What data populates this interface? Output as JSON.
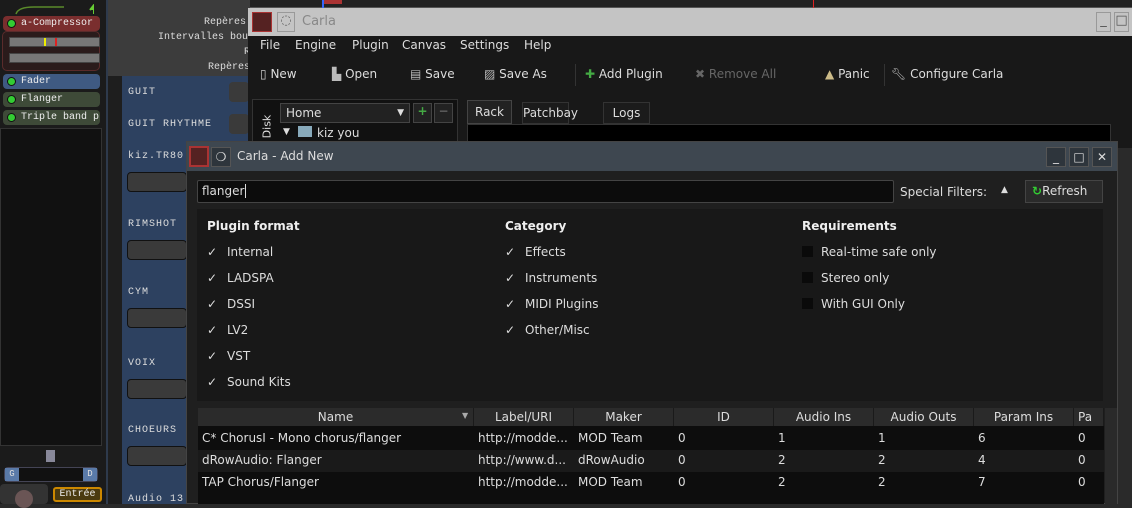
{
  "left_panel": {
    "plugins": [
      {
        "label": "a-Compressor",
        "color": "#7a2e2e"
      },
      {
        "label": "Fader",
        "color": "#3f5a82"
      },
      {
        "label": "Flanger",
        "color": "#3e4a38"
      },
      {
        "label": "Triple band p",
        "color": "#3e4a38"
      }
    ],
    "pan_left": "G",
    "pan_right": "D",
    "input_button": "Entrée"
  },
  "timeline_labels": [
    "Repères",
    "Intervalles bouc",
    "R",
    "Repères"
  ],
  "tracks": [
    "GUIT",
    "GUIT RHYTHME",
    "kiz.TR80",
    "RIMSHOT",
    "CYM",
    "VOIX",
    "CHOEURS",
    "Audio 13"
  ],
  "carla": {
    "title": "Carla",
    "menu": [
      "File",
      "Engine",
      "Plugin",
      "Canvas",
      "Settings",
      "Help"
    ],
    "toolbar": [
      {
        "label": "New",
        "icon": "new-file-icon",
        "enabled": true
      },
      {
        "label": "Open",
        "icon": "open-icon",
        "enabled": true
      },
      {
        "label": "Save",
        "icon": "save-icon",
        "enabled": true
      },
      {
        "label": "Save As",
        "icon": "save-as-icon",
        "enabled": true
      },
      {
        "label": "Add Plugin",
        "icon": "plus-icon",
        "enabled": true
      },
      {
        "label": "Remove All",
        "icon": "x-icon",
        "enabled": false
      },
      {
        "label": "Panic",
        "icon": "warning-icon",
        "enabled": true
      },
      {
        "label": "Configure Carla",
        "icon": "wrench-icon",
        "enabled": true
      }
    ],
    "disk_label": "Disk",
    "disk_select": "Home",
    "tree_item": "kiz you",
    "tabs": [
      "Rack",
      "Patchbay",
      "Logs"
    ]
  },
  "dialog": {
    "title": "Carla - Add New",
    "search_value": "flanger",
    "special_filters": "Special Filters:",
    "refresh": "Refresh",
    "plugin_format": {
      "heading": "Plugin format",
      "items": [
        {
          "label": "Internal",
          "checked": true
        },
        {
          "label": "LADSPA",
          "checked": true
        },
        {
          "label": "DSSI",
          "checked": true
        },
        {
          "label": "LV2",
          "checked": true
        },
        {
          "label": "VST",
          "checked": true
        },
        {
          "label": "Sound Kits",
          "checked": true
        }
      ]
    },
    "category": {
      "heading": "Category",
      "items": [
        {
          "label": "Effects",
          "checked": true
        },
        {
          "label": "Instruments",
          "checked": true
        },
        {
          "label": "MIDI Plugins",
          "checked": true
        },
        {
          "label": "Other/Misc",
          "checked": true
        }
      ]
    },
    "requirements": {
      "heading": "Requirements",
      "items": [
        {
          "label": "Real-time safe only",
          "checked": false
        },
        {
          "label": "Stereo only",
          "checked": false
        },
        {
          "label": "With GUI Only",
          "checked": false
        }
      ]
    },
    "table": {
      "columns": [
        "Name",
        "Label/URI",
        "Maker",
        "ID",
        "Audio Ins",
        "Audio Outs",
        "Param Ins",
        "Pa"
      ],
      "rows": [
        [
          "C* ChorusI - Mono chorus/flanger",
          "http://modde...",
          "MOD Team",
          "0",
          "1",
          "1",
          "6",
          "0"
        ],
        [
          "dRowAudio: Flanger",
          "http://www.d...",
          "dRowAudio",
          "0",
          "2",
          "2",
          "4",
          "0"
        ],
        [
          "TAP Chorus/Flanger",
          "http://modde...",
          "MOD Team",
          "0",
          "2",
          "2",
          "7",
          "0"
        ]
      ]
    }
  }
}
